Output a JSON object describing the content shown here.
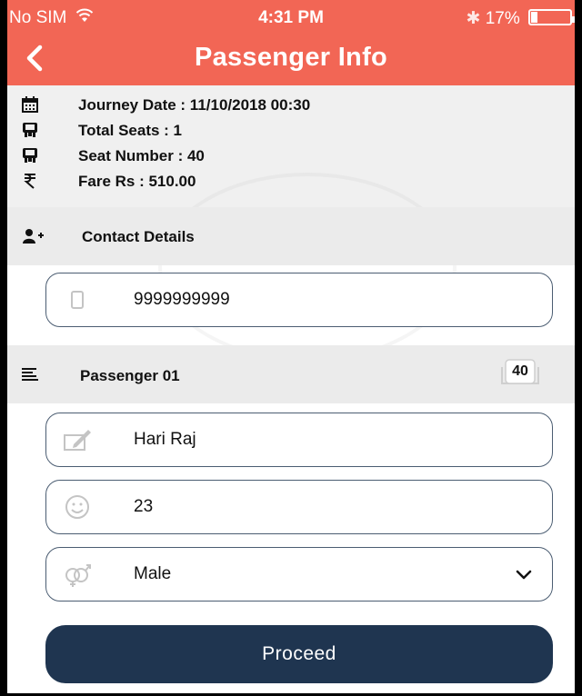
{
  "status_bar": {
    "carrier": "No SIM",
    "time": "4:31 PM",
    "bluetooth": "✱",
    "battery_level": "17%",
    "battery_fraction": 0.17
  },
  "header": {
    "title": "Passenger Info",
    "back_icon": "chevron-left-icon"
  },
  "summary": {
    "journey_date": "Journey Date : 11/10/2018 00:30",
    "total_seats": "Total Seats : 1",
    "seat_number": "Seat Number : 40",
    "fare": "Fare Rs : 510.00"
  },
  "contact": {
    "section_label": "Contact Details",
    "phone_value": "9999999999"
  },
  "passenger": {
    "section_label": "Passenger 01",
    "seat_badge": "40",
    "name_value": "Hari Raj",
    "age_value": "23",
    "gender_value": "Male"
  },
  "actions": {
    "proceed_label": "Proceed"
  },
  "colors": {
    "header": "#f26655",
    "section_bg": "#ebebeb",
    "summary_bg": "#f0f0f0",
    "field_border": "#4b5d72",
    "button": "#1f3550"
  }
}
